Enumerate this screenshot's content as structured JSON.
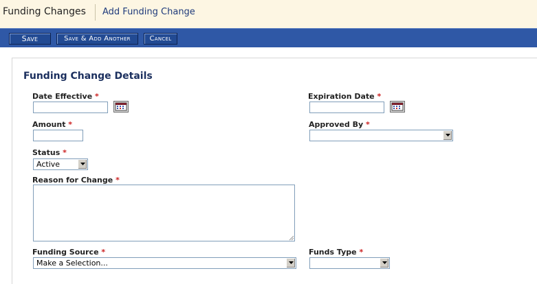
{
  "header": {
    "title": "Funding Changes",
    "subtitle": "Add Funding Change"
  },
  "toolbar": {
    "save_label": "Save",
    "save_add_label": "Save & Add Another",
    "cancel_label": "Cancel"
  },
  "section": {
    "title": "Funding Change Details"
  },
  "form": {
    "required_marker": "*",
    "date_effective": {
      "label": "Date Effective",
      "value": ""
    },
    "expiration_date": {
      "label": "Expiration Date",
      "value": ""
    },
    "amount": {
      "label": "Amount",
      "value": ""
    },
    "approved_by": {
      "label": "Approved By",
      "value": ""
    },
    "status": {
      "label": "Status",
      "value": "Active"
    },
    "reason": {
      "label": "Reason for Change",
      "value": ""
    },
    "funding_source": {
      "label": "Funding Source",
      "value": "Make a Selection..."
    },
    "funds_type": {
      "label": "Funds Type",
      "value": ""
    }
  },
  "icons": {
    "calendar": "calendar-icon",
    "dropdown": "chevron-down-icon"
  },
  "colors": {
    "header_bg": "#fdf6e3",
    "toolbar_bg": "#2f58a6",
    "title_blue": "#1e3a7b",
    "required_red": "#cc2222"
  }
}
